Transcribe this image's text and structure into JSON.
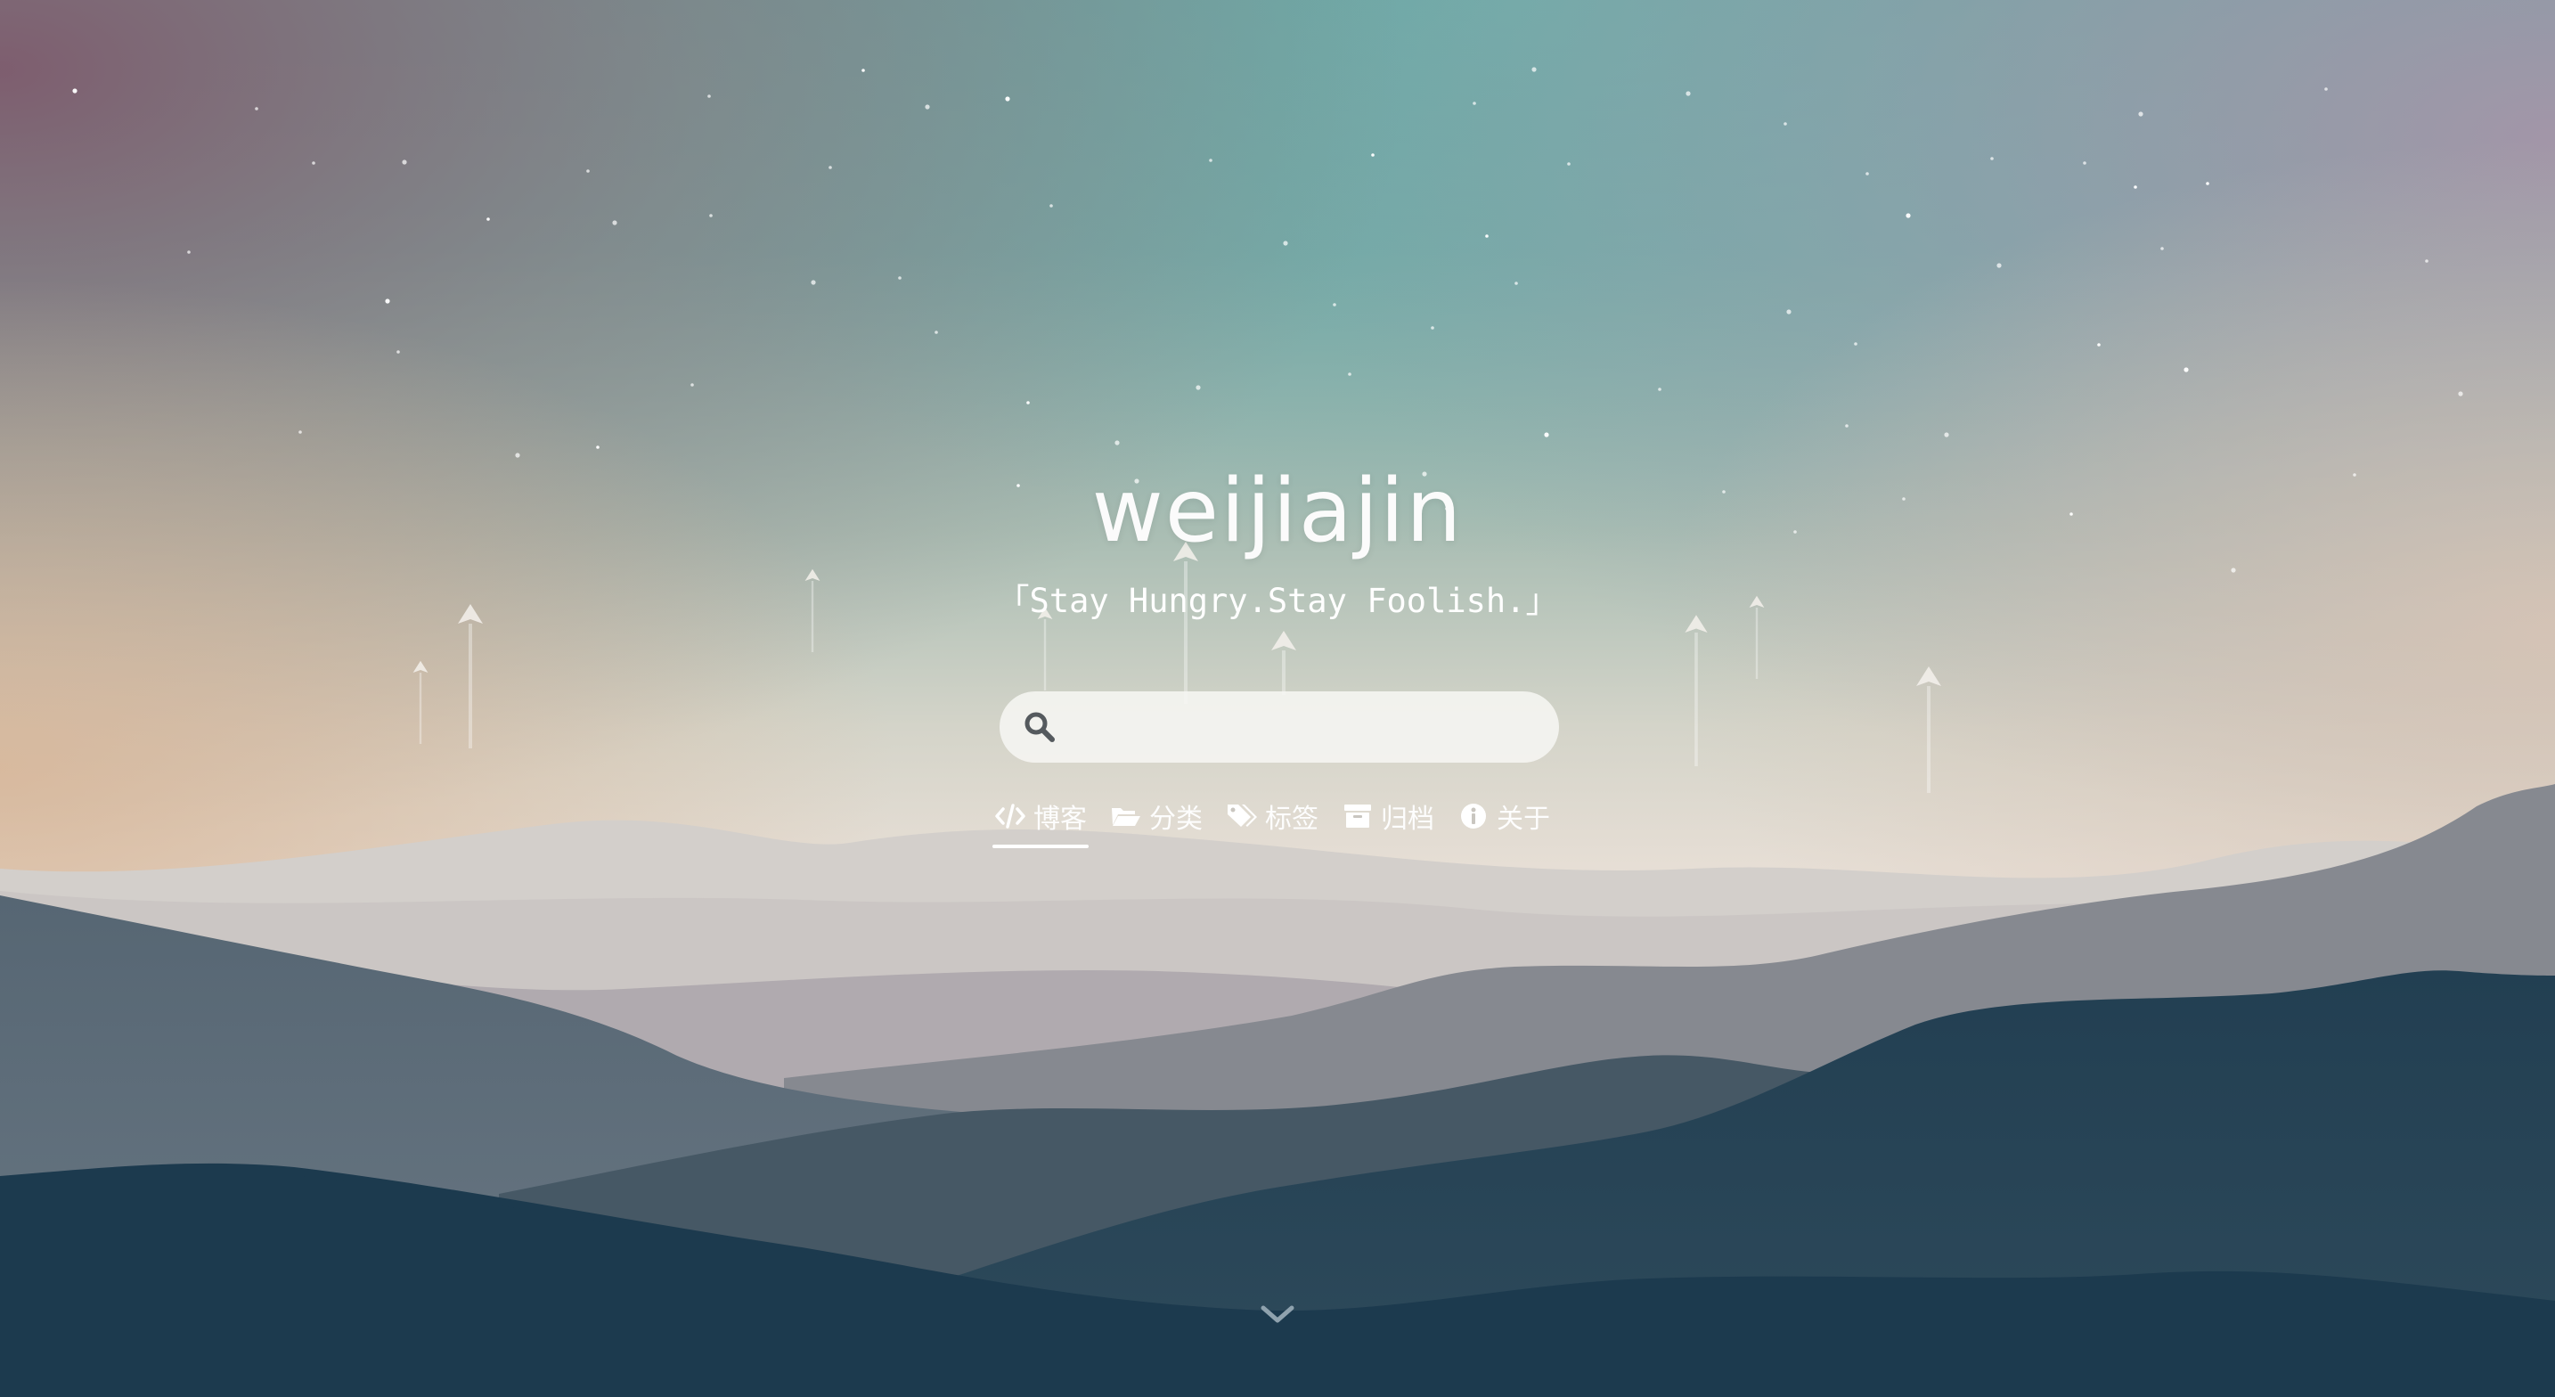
{
  "site": {
    "title": "weijiajin",
    "subtitle": "「Stay Hungry.Stay Foolish.」"
  },
  "search": {
    "placeholder": "",
    "value": "",
    "icon": "search-icon"
  },
  "nav": {
    "items": [
      {
        "label": "博客",
        "icon": "code-icon",
        "active": true
      },
      {
        "label": "分类",
        "icon": "folder-open-icon",
        "active": false
      },
      {
        "label": "标签",
        "icon": "tags-icon",
        "active": false
      },
      {
        "label": "归档",
        "icon": "archive-icon",
        "active": false
      },
      {
        "label": "关于",
        "icon": "info-circle-icon",
        "active": false
      }
    ]
  },
  "scroll_hint": {
    "icon": "chevron-down-icon"
  },
  "colors": {
    "sky_top": "#6f9f9f",
    "horizon": "#e4ddd4",
    "mountain_dark": "#1c3a4e",
    "text": "#ffffff"
  }
}
